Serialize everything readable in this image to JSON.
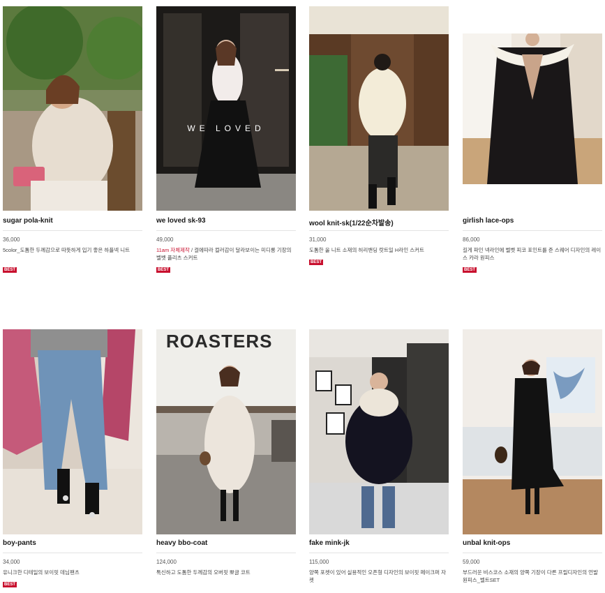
{
  "products": [
    {
      "name": "sugar pola-knit",
      "price": "36,000",
      "desc_highlight": "",
      "desc": "5color_도톰한 두께감으로 따뜻하게 입기 좋은 하플넥 니트",
      "badge": "BEST"
    },
    {
      "name": "we loved sk-93",
      "price": "49,000",
      "desc_highlight": "11am 자체제작",
      "desc": " / 걸에따라 컬러감이 달라보이는 미디롱 기장의 벨벳 플리츠 스커트",
      "badge": "BEST",
      "overlay_text": "WE LOVED"
    },
    {
      "name": "wool knit-sk(1/22순차발송)",
      "price": "31,000",
      "desc_highlight": "",
      "desc": "도톰한 울 니트 소재의 허리밴딩 랏트일 H라인 스커트",
      "badge": "BEST"
    },
    {
      "name": "girlish lace-ops",
      "price": "86,000",
      "desc_highlight": "",
      "desc": "길게 파인 넥라인에 벨벳 피코 포인트를 준 스퀘어 디자인의 레이스 카라 원피스",
      "badge": "BEST"
    },
    {
      "name": "boy-pants",
      "price": "34,000",
      "desc_highlight": "",
      "desc": "유니크한 디테일의 보이핏 데님팬츠",
      "badge": "BEST"
    },
    {
      "name": "heavy bbo-coat",
      "price": "124,000",
      "desc_highlight": "",
      "desc": "톡신하고 도톰한 두께감의 오버핏 뽀글 코트",
      "badge": "",
      "sign_text": "ROASTERS"
    },
    {
      "name": "fake mink-jk",
      "price": "115,000",
      "desc_highlight": "",
      "desc": "양쪽 포켓이 있어 실용적인 오픈형 디자인의 보이핏 페이크퍼 자켓",
      "badge": ""
    },
    {
      "name": "unbal knit-ops",
      "price": "59,000",
      "desc_highlight": "",
      "desc": "부드러운 비스코스 소재의 양쪽 기장이 다른 프릴디자인의 언발 원피스_벨트SET",
      "badge": ""
    }
  ]
}
